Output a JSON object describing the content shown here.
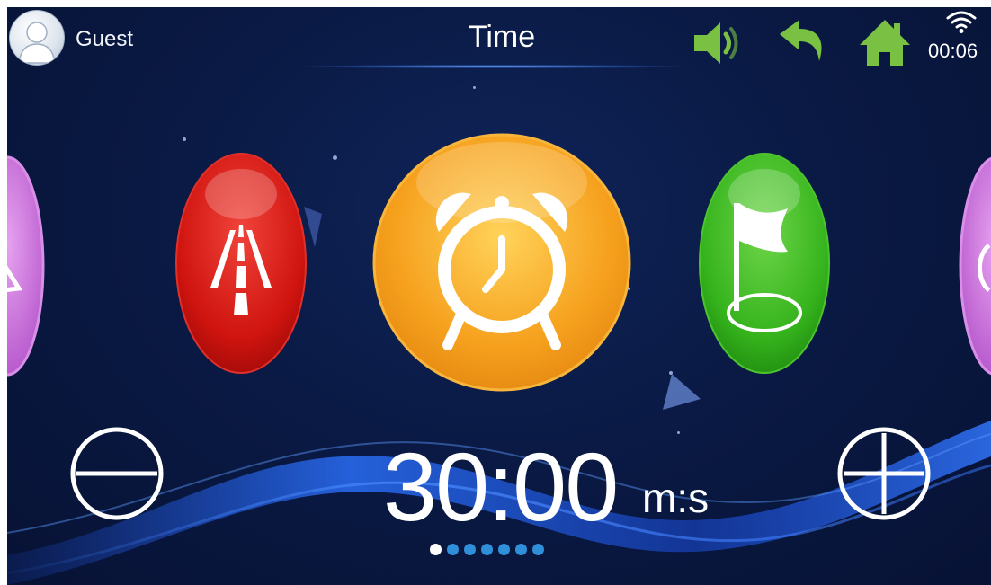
{
  "header": {
    "user_name": "Guest",
    "title": "Time",
    "clock": "00:06",
    "icons": [
      "avatar-icon",
      "volume-icon",
      "back-icon",
      "home-icon",
      "wifi-icon"
    ]
  },
  "modes": [
    {
      "name": "mode-purple-left",
      "color": "#c46ad6",
      "icon": "partial-icon"
    },
    {
      "name": "mode-distance",
      "color": "#d21612",
      "icon": "road-icon"
    },
    {
      "name": "mode-time",
      "color": "#f5a623",
      "icon": "alarm-clock-icon",
      "selected": true
    },
    {
      "name": "mode-goal",
      "color": "#35b31c",
      "icon": "flag-icon"
    },
    {
      "name": "mode-purple-right",
      "color": "#c46ad6",
      "icon": "partial-icon"
    }
  ],
  "timer": {
    "value": "30:00",
    "unit": "m:s"
  },
  "pagination": {
    "total": 7,
    "active": 0
  },
  "colors": {
    "accent_green": "#7ac143",
    "background": "#0a1a45",
    "dot": "#2f8fd8"
  }
}
